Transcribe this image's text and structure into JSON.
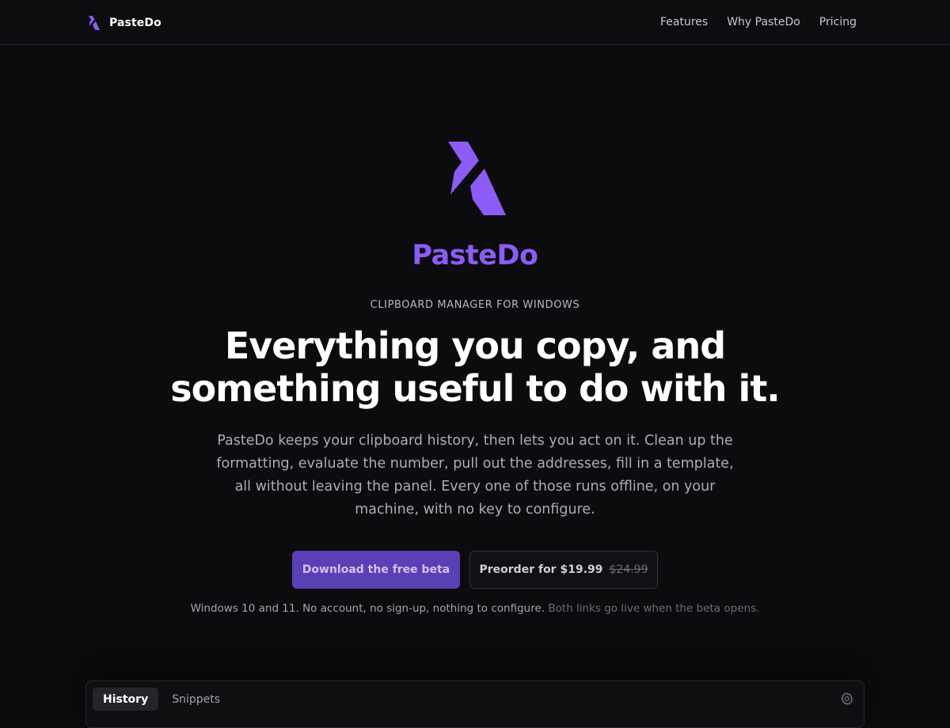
{
  "brand": {
    "name": "PasteDo",
    "accent": "#8b5cf6"
  },
  "nav": {
    "items": [
      "Features",
      "Why PasteDo",
      "Pricing"
    ]
  },
  "hero": {
    "wordmark": "PasteDo",
    "eyebrow": "CLIPBOARD MANAGER FOR WINDOWS",
    "headline_line1": "Everything you copy, and",
    "headline_line2": "something useful to do with it.",
    "lede": "PasteDo keeps your clipboard history, then lets you act on it. Clean up the formatting, evaluate the number, pull out the addresses, fill in a template, all without leaving the panel. Every one of those runs offline, on your machine, with no key to configure."
  },
  "cta": {
    "primary_label": "Download the free beta",
    "secondary_label": "Preorder for $19.99",
    "secondary_old_price": "$24.99",
    "fineprint": "Windows 10 and 11. No account, no sign-up, nothing to configure.",
    "fineprint_muted": "Both links go live when the beta opens."
  },
  "panel": {
    "tabs": [
      {
        "label": "History",
        "active": true
      },
      {
        "label": "Snippets",
        "active": false
      }
    ],
    "settings_icon": "gear-icon"
  }
}
